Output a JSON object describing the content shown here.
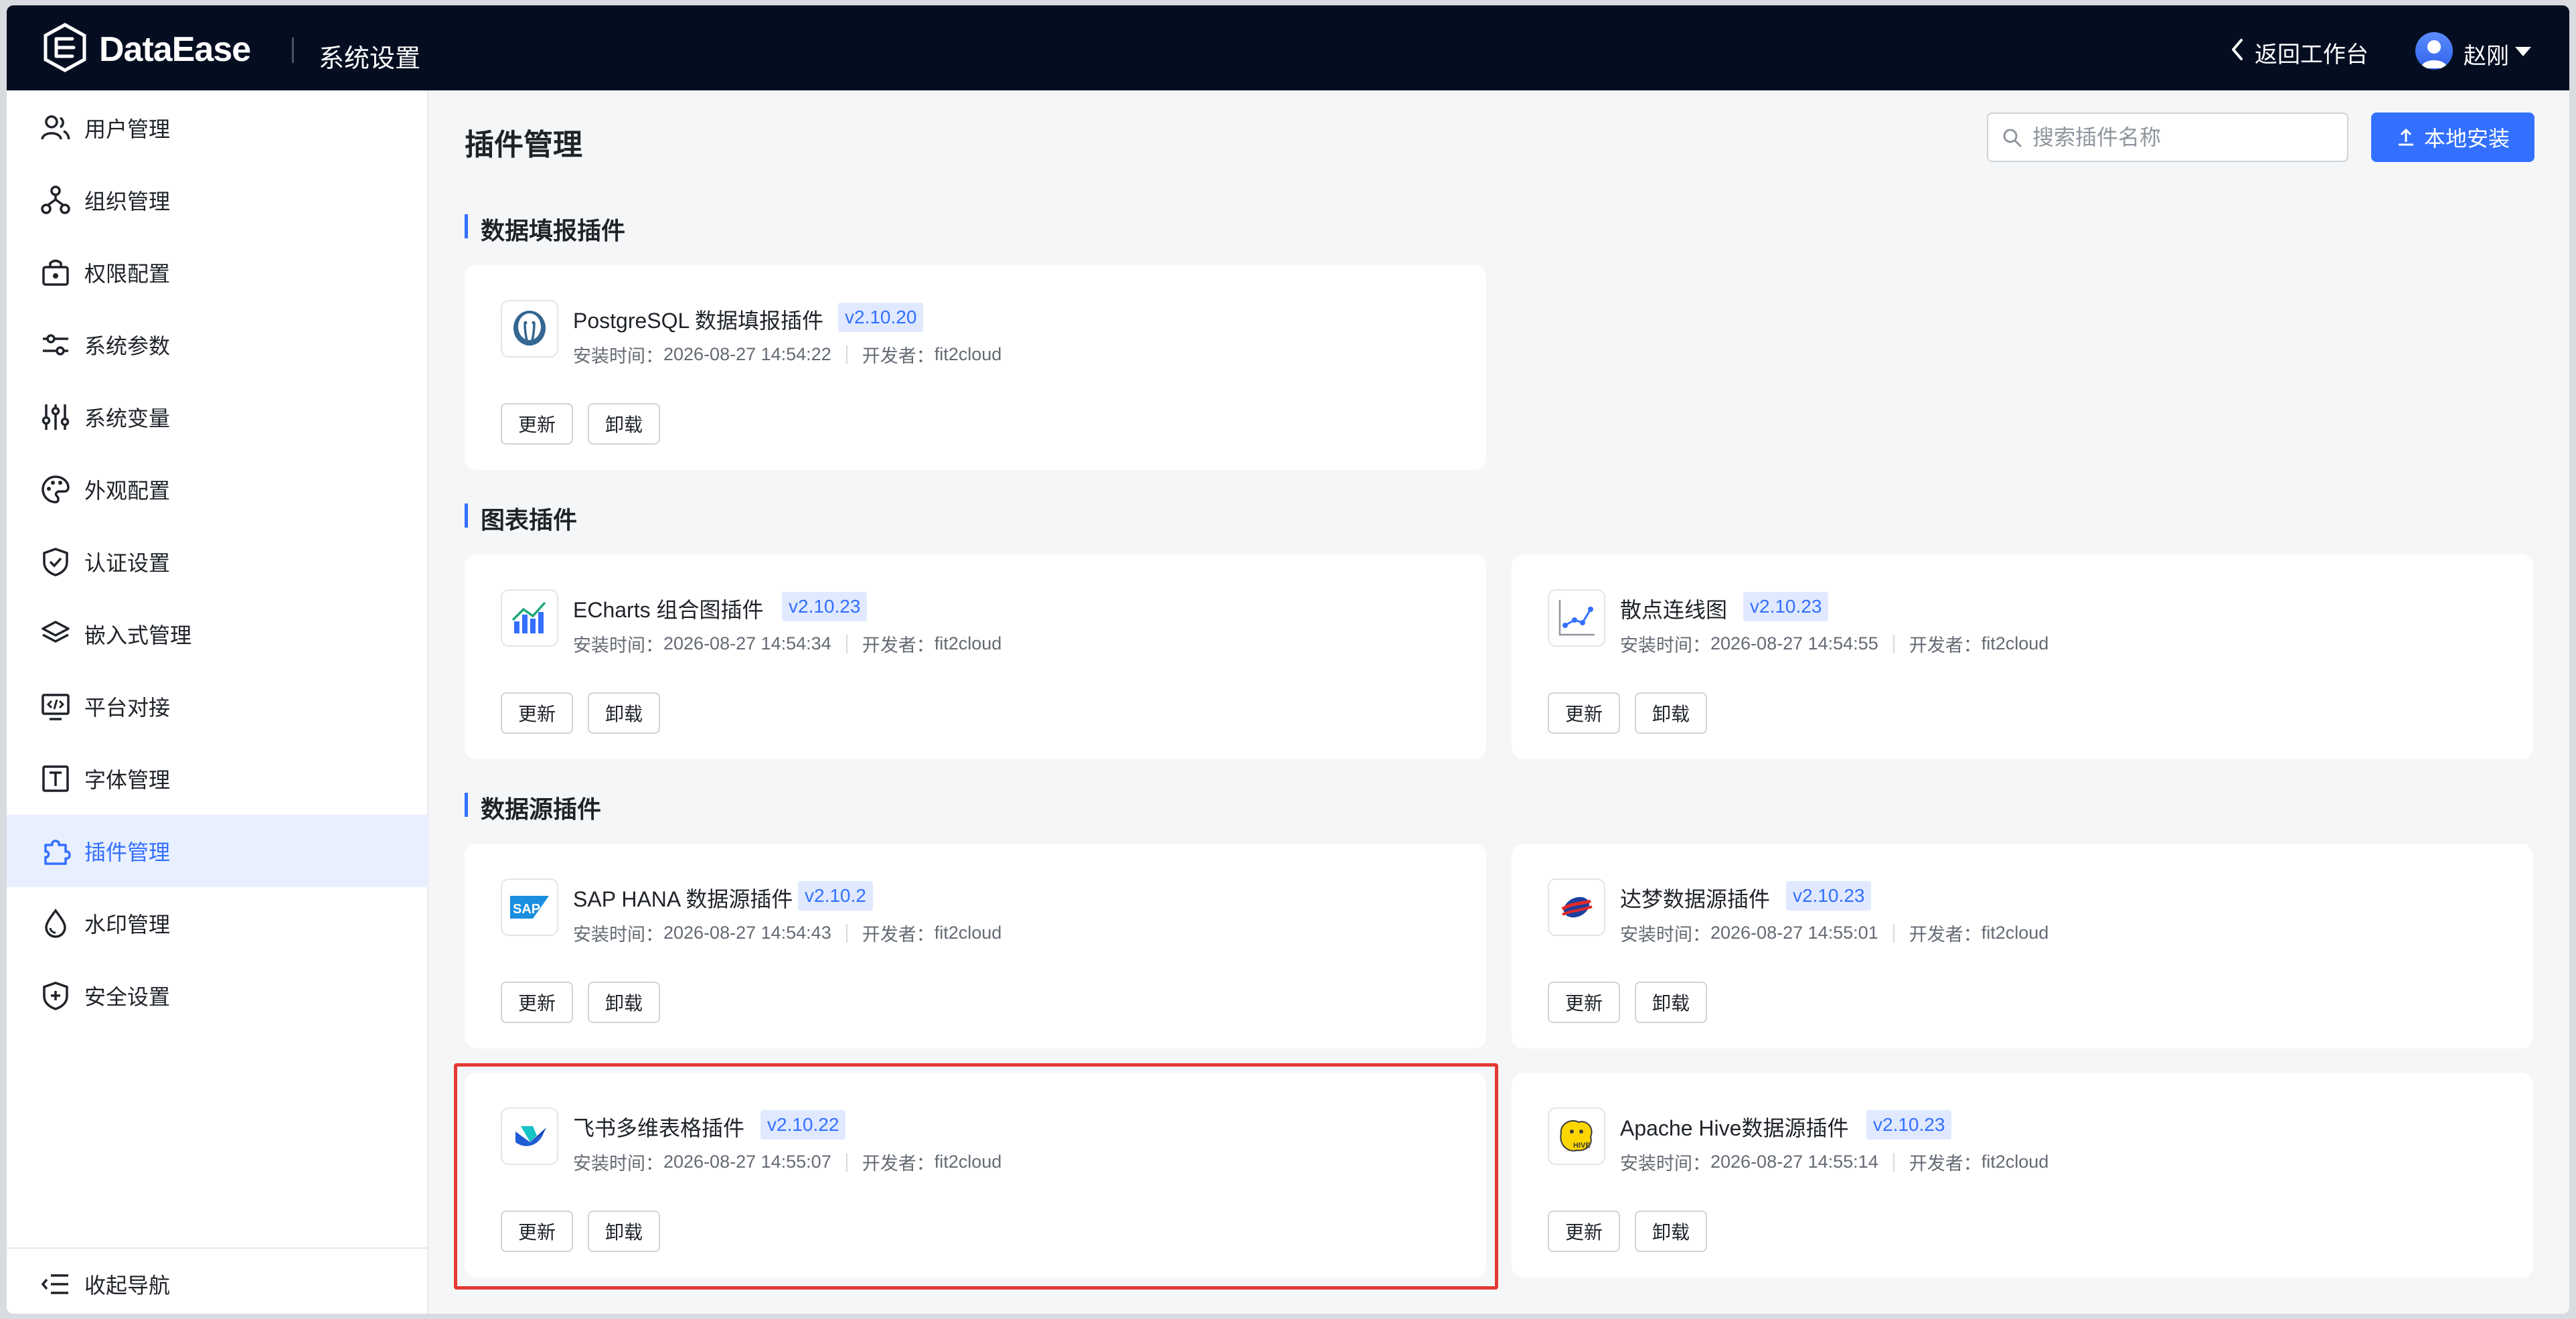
{
  "header": {
    "logo_text": "DataEase",
    "section_title": "系统设置",
    "back_label": "返回工作台",
    "user_name": "赵刚"
  },
  "sidebar": {
    "items": [
      {
        "label": "用户管理",
        "icon": "users-icon"
      },
      {
        "label": "组织管理",
        "icon": "org-tree-icon"
      },
      {
        "label": "权限配置",
        "icon": "permission-icon"
      },
      {
        "label": "系统参数",
        "icon": "sliders-icon"
      },
      {
        "label": "系统变量",
        "icon": "variables-icon"
      },
      {
        "label": "外观配置",
        "icon": "palette-icon"
      },
      {
        "label": "认证设置",
        "icon": "shield-check-icon"
      },
      {
        "label": "嵌入式管理",
        "icon": "layers-icon"
      },
      {
        "label": "平台对接",
        "icon": "platform-icon"
      },
      {
        "label": "字体管理",
        "icon": "font-icon"
      },
      {
        "label": "插件管理",
        "icon": "plugin-icon",
        "active": true
      },
      {
        "label": "水印管理",
        "icon": "watermark-icon"
      },
      {
        "label": "安全设置",
        "icon": "shield-plus-icon"
      }
    ],
    "collapse_label": "收起导航"
  },
  "main": {
    "title": "插件管理",
    "search_placeholder": "搜索插件名称",
    "install_label": "本地安装",
    "install_time_label": "安装时间：",
    "developer_label": "开发者：",
    "update_label": "更新",
    "uninstall_label": "卸载",
    "sections": [
      {
        "title": "数据填报插件",
        "plugins": [
          {
            "name": "PostgreSQL 数据填报插件",
            "version": "v2.10.20",
            "installed": "2026-08-27 14:54:22",
            "developer": "fit2cloud",
            "icon": "postgresql-icon"
          }
        ]
      },
      {
        "title": "图表插件",
        "plugins": [
          {
            "name": "ECharts 组合图插件",
            "version": "v2.10.23",
            "installed": "2026-08-27 14:54:34",
            "developer": "fit2cloud",
            "icon": "echarts-icon"
          },
          {
            "name": "散点连线图",
            "version": "v2.10.23",
            "installed": "2026-08-27 14:54:55",
            "developer": "fit2cloud",
            "icon": "scatter-line-icon"
          }
        ]
      },
      {
        "title": "数据源插件",
        "plugins": [
          {
            "name": "SAP HANA 数据源插件",
            "version": "v2.10.2",
            "installed": "2026-08-27 14:54:43",
            "developer": "fit2cloud",
            "icon": "sap-icon"
          },
          {
            "name": "达梦数据源插件",
            "version": "v2.10.23",
            "installed": "2026-08-27 14:55:01",
            "developer": "fit2cloud",
            "icon": "dameng-icon"
          },
          {
            "name": "飞书多维表格插件",
            "version": "v2.10.22",
            "installed": "2026-08-27 14:55:07",
            "developer": "fit2cloud",
            "icon": "feishu-icon"
          },
          {
            "name": "Apache Hive数据源插件",
            "version": "v2.10.23",
            "installed": "2026-08-27 14:55:14",
            "developer": "fit2cloud",
            "icon": "hive-icon"
          }
        ]
      }
    ]
  },
  "colors": {
    "header_bg": "#050e21",
    "accent": "#3370ff",
    "highlight": "#e53935"
  }
}
